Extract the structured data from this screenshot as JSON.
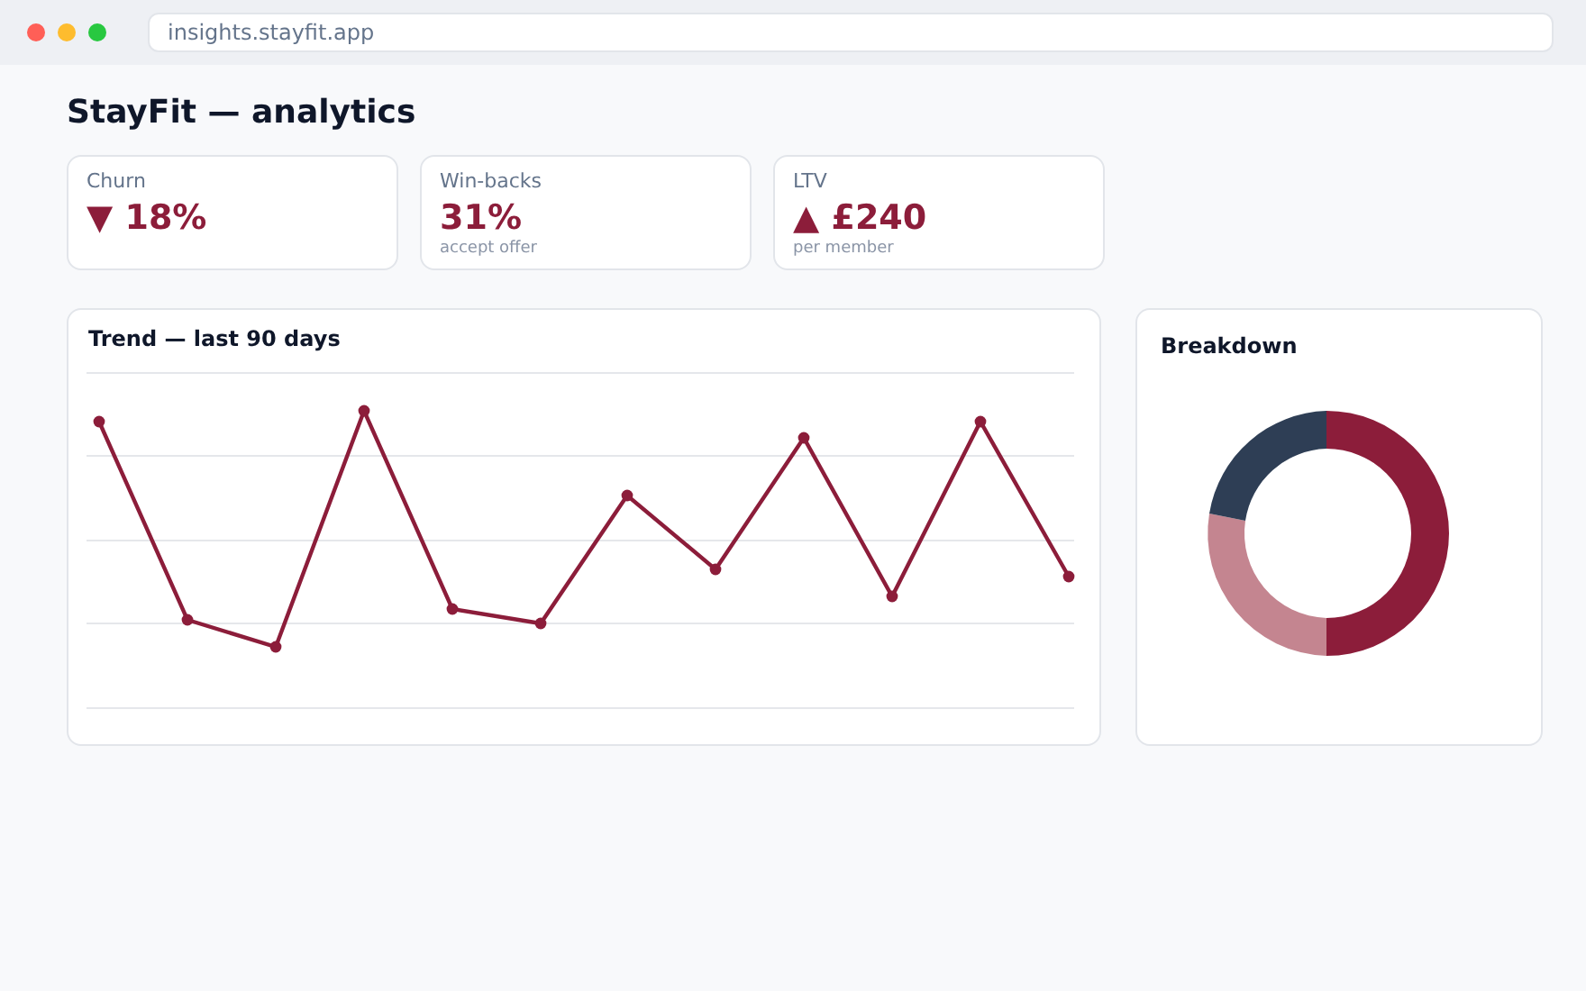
{
  "browser": {
    "url": "insights.stayfit.app"
  },
  "page": {
    "title": "StayFit — analytics"
  },
  "kpis": [
    {
      "label": "Churn",
      "value": "▼ 18%"
    },
    {
      "label": "Win-backs",
      "value": "31%",
      "note": "accept offer"
    },
    {
      "label": "LTV",
      "value": "▲ £240",
      "note": "per member"
    }
  ],
  "trend": {
    "title": "Trend — last 90 days"
  },
  "breakdown": {
    "title": "Breakdown"
  }
}
